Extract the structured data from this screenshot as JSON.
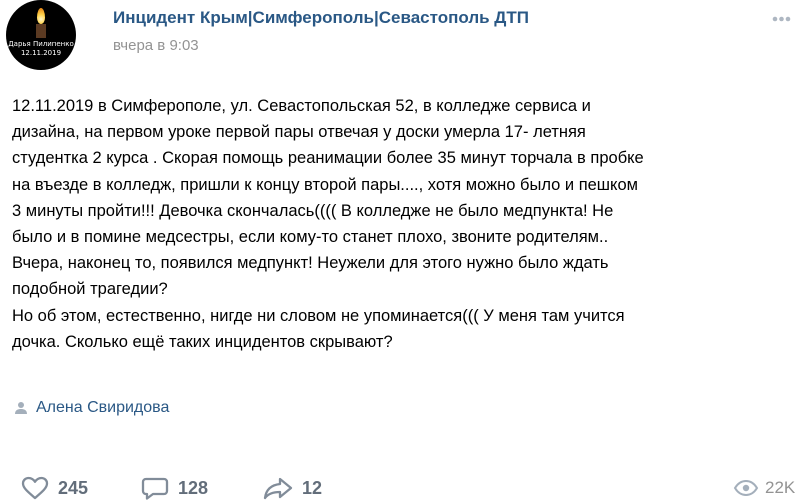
{
  "header": {
    "avatar_caption_name": "Дарья Пилипенко",
    "avatar_caption_date": "12.11.2019",
    "group_name": "Инцидент Крым|Симферополь|Севастополь ДТП",
    "time": "вчера в 9:03"
  },
  "post": {
    "lines": [
      "12.11.2019 в Симферополе, ул. Севастопольская 52, в колледже сервиса и",
      "дизайна, на первом уроке первой пары отвечая у доски умерла 17- летняя",
      "студентка 2 курса . Скорая помощь реанимации более 35 минут торчала в пробке",
      "на въезде в колледж, пришли к концу второй пары...., хотя можно было и пешком",
      "3 минуты пройти!!! Девочка скончалась(((( В колледже не было медпункта! Не",
      "было и в помине медсестры, если кому-то станет плохо, звоните родителям..",
      "Вчера, наконец то, появился медпункт! Неужели для этого нужно было ждать",
      "подобной трагедии?",
      "Но об этом, естественно, нигде ни словом не упоминается((( У меня там учится",
      "дочка. Сколько ещё таких инцидентов скрывают?"
    ]
  },
  "author": {
    "name": "Алена Свиридова",
    "icon": "person-icon"
  },
  "actions": {
    "likes": "245",
    "comments": "128",
    "shares": "12",
    "views": "22K"
  },
  "colors": {
    "link": "#2a5885",
    "muted": "#939393",
    "icon": "#818c99"
  }
}
